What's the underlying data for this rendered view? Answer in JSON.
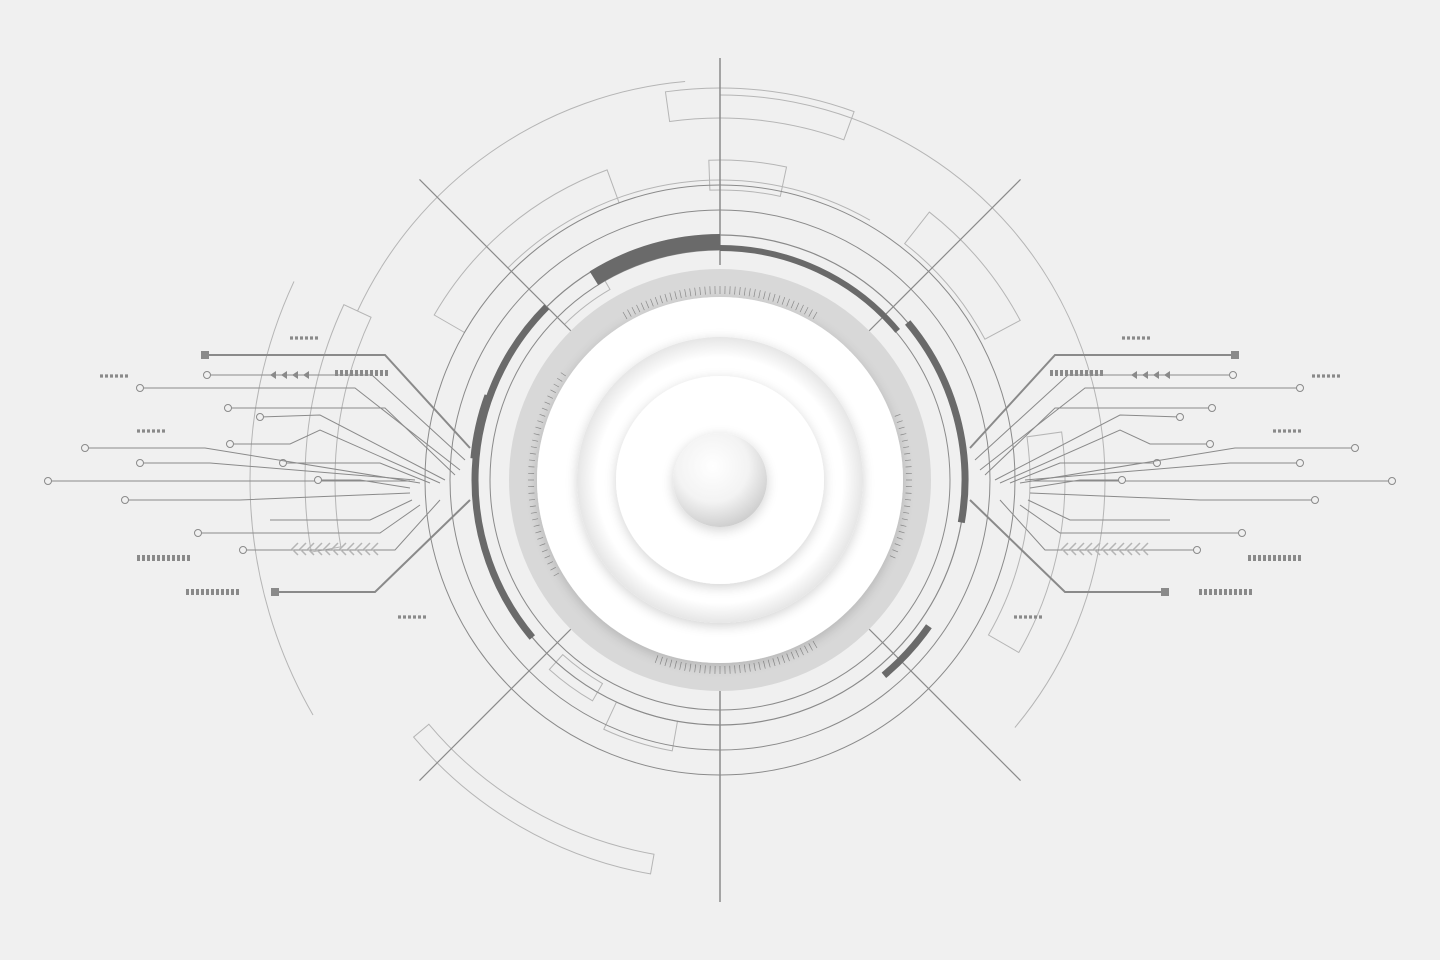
{
  "colors": {
    "background": "#f0f0f0",
    "line": "#8a8a8a",
    "line_light": "#b5b5b5",
    "line_faint": "#c9c9c9",
    "accent_dark": "#6a6a6a",
    "ring_mid": "#d8d8d8",
    "ring_white": "#ffffff",
    "ring_shadow": "#e3e3e3"
  },
  "icons": {
    "center": "sphere-icon",
    "connectors": "circle-node-icon",
    "arrows": "chevron-arrow-icon"
  }
}
